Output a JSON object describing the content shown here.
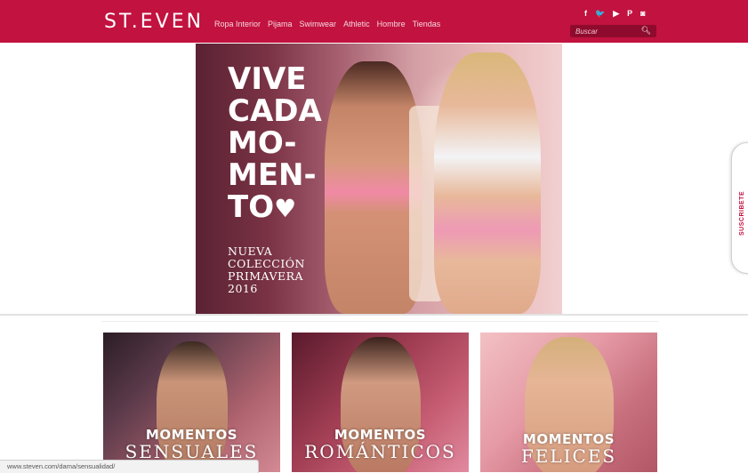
{
  "header": {
    "logo": "ST.EVEN",
    "nav": [
      "Ropa Interior",
      "Pijama",
      "Swimwear",
      "Athletic",
      "Hombre",
      "Tiendas"
    ],
    "social_icons": [
      {
        "name": "facebook-icon",
        "glyph": "f"
      },
      {
        "name": "twitter-icon",
        "glyph": "🐦"
      },
      {
        "name": "youtube-icon",
        "glyph": "▶"
      },
      {
        "name": "pinterest-icon",
        "glyph": "P"
      },
      {
        "name": "instagram-icon",
        "glyph": "◙"
      }
    ],
    "search": {
      "placeholder": "Buscar",
      "icon": "search-icon"
    }
  },
  "hero": {
    "headline": [
      "VIVE",
      "CADA",
      "MO-",
      "MEN-",
      "TO"
    ],
    "collection": [
      "NUEVA",
      "COLECCIÓN",
      "PRIMAVERA",
      "2016"
    ]
  },
  "side_tab": {
    "label": "SUSCRIBETE"
  },
  "cards": [
    {
      "title": "MOMENTOS",
      "subtitle": "SENSUALES"
    },
    {
      "title": "MOMENTOS",
      "subtitle": "ROMÁNTICOS"
    },
    {
      "title": "MOMENTOS",
      "subtitle": "FELICES"
    }
  ],
  "status_bar": {
    "url": "www.steven.com/dama/sensualidad/"
  },
  "colors": {
    "brand": "#c2123f",
    "search_bg": "#8e0b2d"
  }
}
